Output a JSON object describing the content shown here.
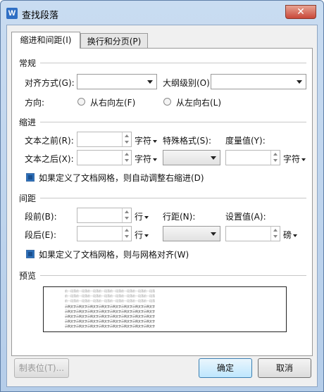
{
  "window": {
    "app_icon": "W",
    "title": "查找段落",
    "close_glyph": "✕"
  },
  "tabs": [
    {
      "label": "缩进和间距(I)",
      "active": true
    },
    {
      "label": "换行和分页(P)",
      "active": false
    }
  ],
  "general": {
    "heading": "常规",
    "alignment_label": "对齐方式(G):",
    "alignment_value": "",
    "outline_label": "大纲级别(O):",
    "outline_value": "",
    "direction_label": "方向:",
    "rtl_label": "从右向左(F)",
    "ltr_label": "从左向右(L)"
  },
  "indent": {
    "heading": "缩进",
    "before_label": "文本之前(R):",
    "before_value": "",
    "before_unit": "字符",
    "after_label": "文本之后(X):",
    "after_value": "",
    "after_unit": "字符",
    "special_label": "特殊格式(S):",
    "special_value": "",
    "measure_label": "度量值(Y):",
    "measure_value": "",
    "measure_unit": "字符",
    "grid_checkbox_label": "如果定义了文档网格，则自动调整右缩进(D)"
  },
  "spacing": {
    "heading": "间距",
    "before_label": "段前(B):",
    "before_value": "",
    "before_unit": "行",
    "after_label": "段后(E):",
    "after_value": "",
    "after_unit": "行",
    "line_label": "行距(N):",
    "line_value": "",
    "setting_label": "设置值(A):",
    "setting_value": "",
    "setting_unit": "磅",
    "grid_checkbox_label": "如果定义了文档网格，则与网格对齐(W)"
  },
  "preview": {
    "heading": "预览",
    "prev_line": "前一段落前一段落前一段落前一段落前一段落前一段落前一段落前一段落",
    "body_line": "示例文字示例文字示例文字示例文字示例文字示例文字示例文字示例文字"
  },
  "buttons": {
    "tabs": "制表位(T)...",
    "ok": "确定",
    "cancel": "取消"
  },
  "colors": {
    "accent": "#2c6fb8",
    "title_bar": "#c9dcf1",
    "close": "#c9483a"
  }
}
